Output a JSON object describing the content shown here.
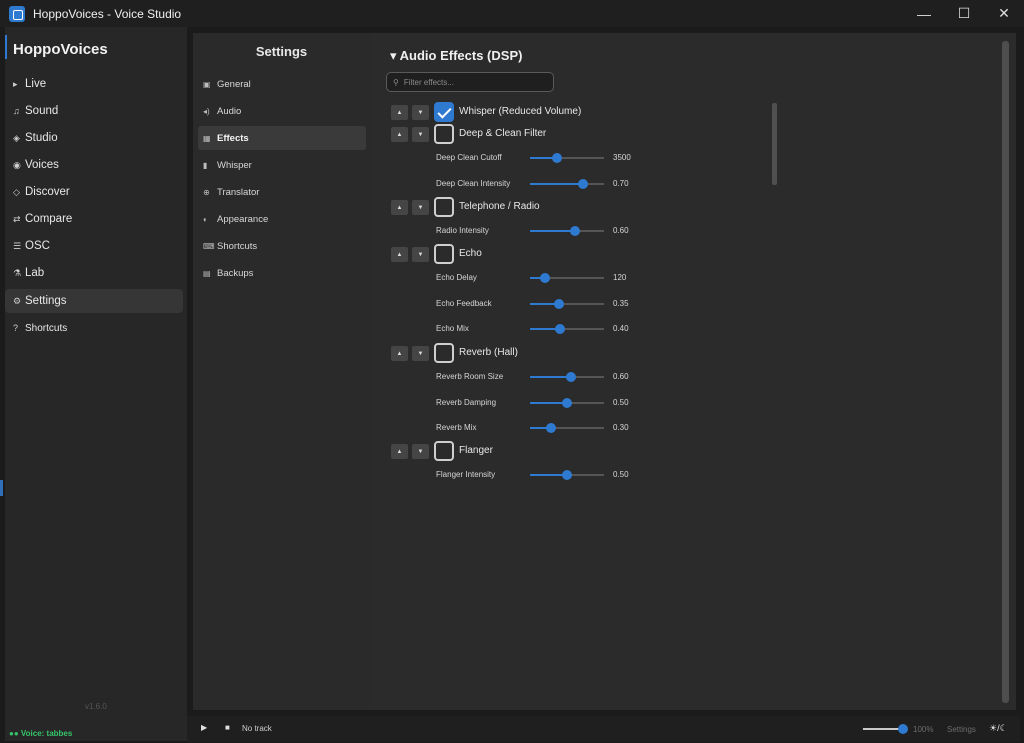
{
  "window": {
    "title": "HoppoVoices - Voice Studio",
    "controls": {
      "minimize": "—",
      "maximize": "☐",
      "close": "✕"
    }
  },
  "sidebar": {
    "brand": "HoppoVoices",
    "items": [
      {
        "label": "Live",
        "icon": "▸"
      },
      {
        "label": "Sound",
        "icon": "♫"
      },
      {
        "label": "Studio",
        "icon": "◈"
      },
      {
        "label": "Voices",
        "icon": "◉"
      },
      {
        "label": "Discover",
        "icon": "◇"
      },
      {
        "label": "Compare",
        "icon": "⇄"
      },
      {
        "label": "OSC",
        "icon": "☰"
      },
      {
        "label": "Lab",
        "icon": "⚗"
      },
      {
        "label": "Settings",
        "icon": "⚙"
      },
      {
        "label": "Shortcuts",
        "icon": "?"
      }
    ],
    "version": "v1.6.0",
    "voice_status": "●● Voice: tabbes"
  },
  "settings_nav": {
    "title": "Settings",
    "items": [
      {
        "label": "General",
        "icon": "▣"
      },
      {
        "label": "Audio",
        "icon": "◂)"
      },
      {
        "label": "Effects",
        "icon": "▦"
      },
      {
        "label": "Whisper",
        "icon": "▮"
      },
      {
        "label": "Translator",
        "icon": "⊕"
      },
      {
        "label": "Appearance",
        "icon": "◐"
      },
      {
        "label": "Shortcuts",
        "icon": "⌨"
      },
      {
        "label": "Backups",
        "icon": "▤"
      }
    ]
  },
  "effects": {
    "title": "▾  Audio Effects (DSP)",
    "filter_placeholder": "Filter effects...",
    "move_up": "▲",
    "move_down": "▼",
    "list": [
      {
        "name": "Whisper (Reduced Volume)",
        "enabled": true,
        "params": []
      },
      {
        "name": "Deep & Clean Filter",
        "enabled": false,
        "params": [
          {
            "label": "Deep Clean Cutoff",
            "value": "3500",
            "level": 0.36
          },
          {
            "label": "Deep Clean Intensity",
            "value": "0.70",
            "level": 0.72
          }
        ]
      },
      {
        "name": "Telephone / Radio",
        "enabled": false,
        "params": [
          {
            "label": "Radio Intensity",
            "value": "0.60",
            "level": 0.61
          }
        ]
      },
      {
        "name": "Echo",
        "enabled": false,
        "params": [
          {
            "label": "Echo Delay",
            "value": "120",
            "level": 0.2
          },
          {
            "label": "Echo Feedback",
            "value": "0.35",
            "level": 0.39
          },
          {
            "label": "Echo Mix",
            "value": "0.40",
            "level": 0.41
          }
        ]
      },
      {
        "name": "Reverb (Hall)",
        "enabled": false,
        "params": [
          {
            "label": "Reverb Room Size",
            "value": "0.60",
            "level": 0.56
          },
          {
            "label": "Reverb Damping",
            "value": "0.50",
            "level": 0.5
          },
          {
            "label": "Reverb Mix",
            "value": "0.30",
            "level": 0.28
          }
        ]
      },
      {
        "name": "Flanger",
        "enabled": false,
        "params": [
          {
            "label": "Flanger Intensity",
            "value": "0.50",
            "level": 0.5
          }
        ]
      }
    ]
  },
  "player": {
    "play": "▶",
    "stop": "■",
    "track": "No track",
    "volume_label": "100%",
    "volume_level": 0.95,
    "settings_label": "Settings",
    "theme_toggle": "☀/☾"
  },
  "colors": {
    "accent": "#2f7ad1",
    "status_green": "#35c46a"
  }
}
